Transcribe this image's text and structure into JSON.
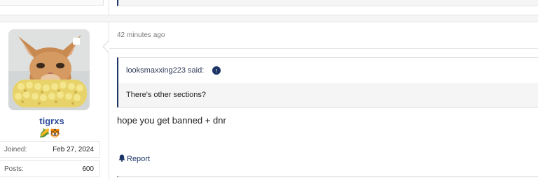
{
  "post": {
    "timestamp": "42 minutes ago",
    "quote": {
      "author_line": "looksmaxxing223 said:",
      "jump_icon": "arrow-up-circle-icon",
      "text": "There's other sections?"
    },
    "message": "hope you get banned + dnr",
    "actions": {
      "report_label": "Report",
      "report_icon": "bell-icon"
    }
  },
  "user": {
    "username": "tigrxs",
    "badges": [
      "🌽",
      "🐯"
    ],
    "stats": {
      "joined_label": "Joined:",
      "joined_value": "Feb 27, 2024",
      "posts_label": "Posts:",
      "posts_value": "600"
    }
  },
  "colors": {
    "accent": "#1d3566",
    "username": "#2b4a9c"
  }
}
